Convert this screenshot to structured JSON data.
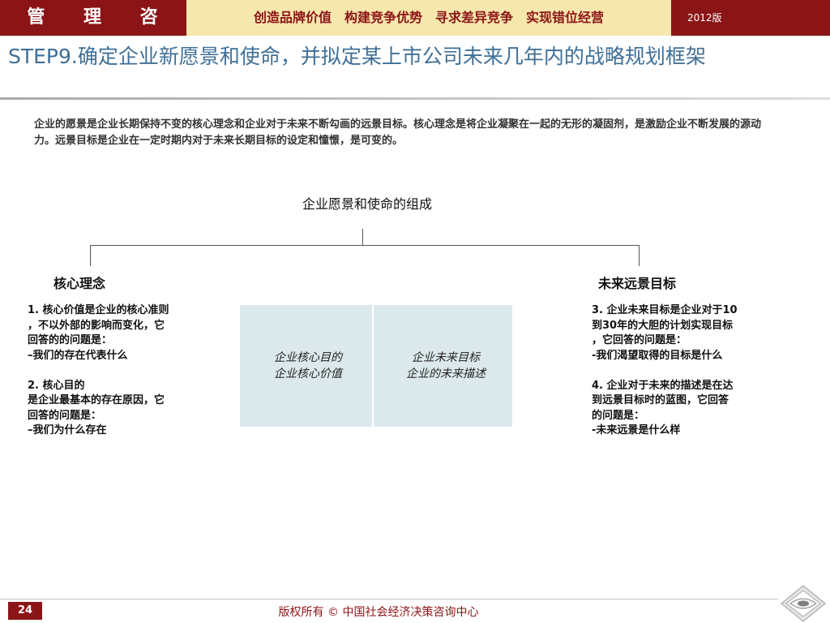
{
  "header": {
    "brand": "管 理 咨 询",
    "slogan": "创造品牌价值　构建竞争优势　寻求差异竞争　实现错位经营",
    "edition": "2012版"
  },
  "title": "STEP9.确定企业新愿景和使命，并拟定某上市公司未来几年内的战略规划框架",
  "intro": "企业的愿景是企业长期保持不变的核心理念和企业对于未来不断勾画的远景目标。核心理念是将企业凝聚在一起的无形的凝固剂，是激励企业不断发展的源动力。远景目标是企业在一定时期内对于未来长期目标的设定和憧憬，是可变的。",
  "chart": {
    "title": "企业愿景和使命的组成",
    "left_node": "核心理念",
    "right_node": "未来远景目标",
    "left_desc": "1. 核心价值是企业的核心准则\n，不以外部的影响而变化，它\n回答的的问题是：\n–我们的存在代表什么\n\n2.  核心目的\n是企业最基本的存在原因，它\n回答的问题是：\n–我们为什么存在",
    "right_desc": "3. 企业未来目标是企业对于10\n到30年的大胆的计划实现目标\n，它回答的问题是：\n-我们渴望取得的目标是什么\n\n4. 企业对于未来的描述是在达\n到远景目标时的蓝图，它回答\n的问题是：\n-未来远景是什么样",
    "center_left": "企业核心目的\n企业核心价值",
    "center_right": "企业未来目标\n企业的未来描述"
  },
  "footer": {
    "page_number": "24",
    "copyright": "版权所有 © 中国社会经济决策咨询中心"
  }
}
